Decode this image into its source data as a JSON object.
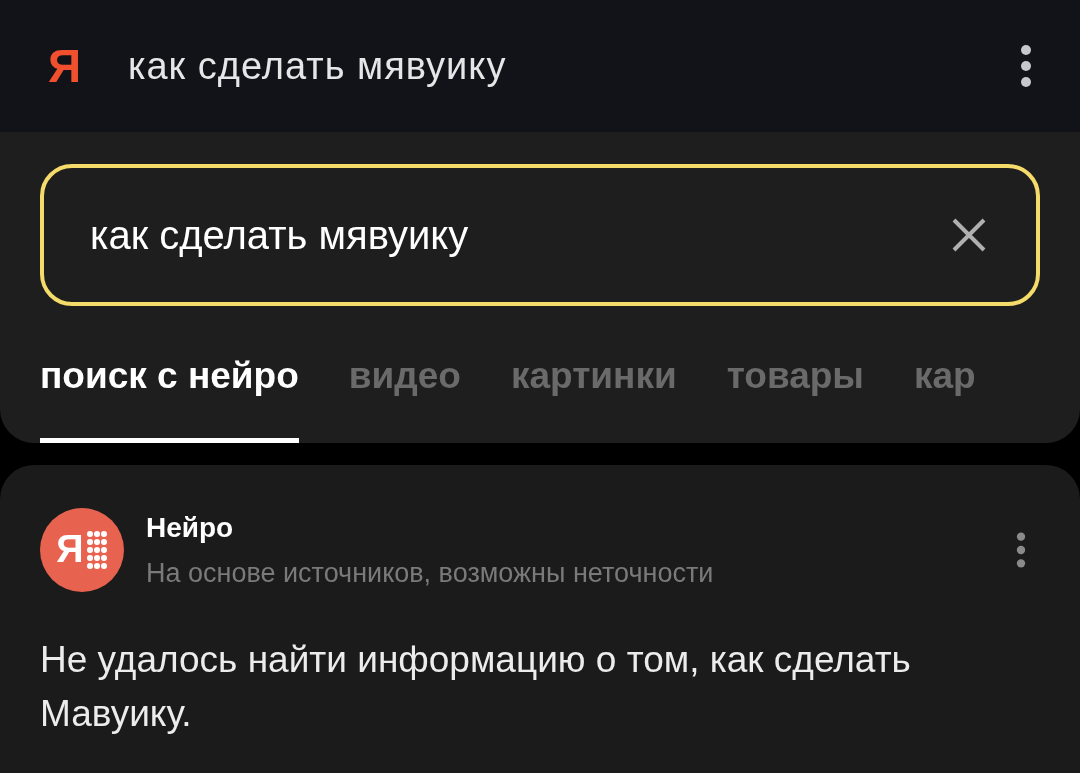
{
  "top_bar": {
    "logo": "Я",
    "query": "как сделать мявуику"
  },
  "search": {
    "value": "как сделать мявуику"
  },
  "tabs": [
    {
      "label": "поиск с нейро",
      "selected": true
    },
    {
      "label": "видео",
      "selected": false
    },
    {
      "label": "картинки",
      "selected": false
    },
    {
      "label": "товары",
      "selected": false
    },
    {
      "label": "кар",
      "selected": false
    }
  ],
  "answer": {
    "avatar_letter": "Я",
    "title": "Нейро",
    "subtitle": "На основе источников, возможны неточности",
    "text": "Не удалось найти информацию о том, как сделать Мавуику."
  }
}
